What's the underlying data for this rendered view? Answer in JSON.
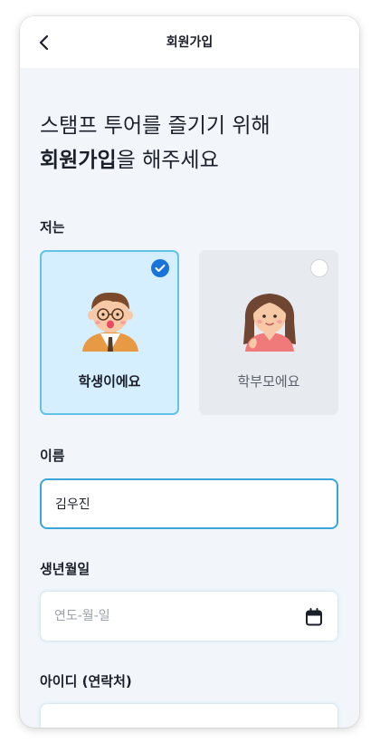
{
  "header": {
    "title": "회원가입"
  },
  "headline": {
    "line1": "스탬프 투어를 즐기기 위해",
    "line2_bold": "회원가입",
    "line2_rest": "을 해주세요"
  },
  "role": {
    "label": "저는",
    "options": [
      {
        "label": "학생이에요",
        "selected": true
      },
      {
        "label": "학부모에요",
        "selected": false
      }
    ]
  },
  "name": {
    "label": "이름",
    "value": "김우진"
  },
  "birth": {
    "label": "생년월일",
    "placeholder": "연도-월-일"
  },
  "userid": {
    "label": "아이디 (연락처)",
    "value": ""
  },
  "colors": {
    "accent": "#1a73d9",
    "selected_bg": "#d5efff",
    "selected_border": "#62c2e7",
    "background": "#f2f6fb"
  },
  "icons": {
    "back": "chevron-left-icon",
    "check": "check-icon",
    "calendar": "calendar-icon"
  }
}
